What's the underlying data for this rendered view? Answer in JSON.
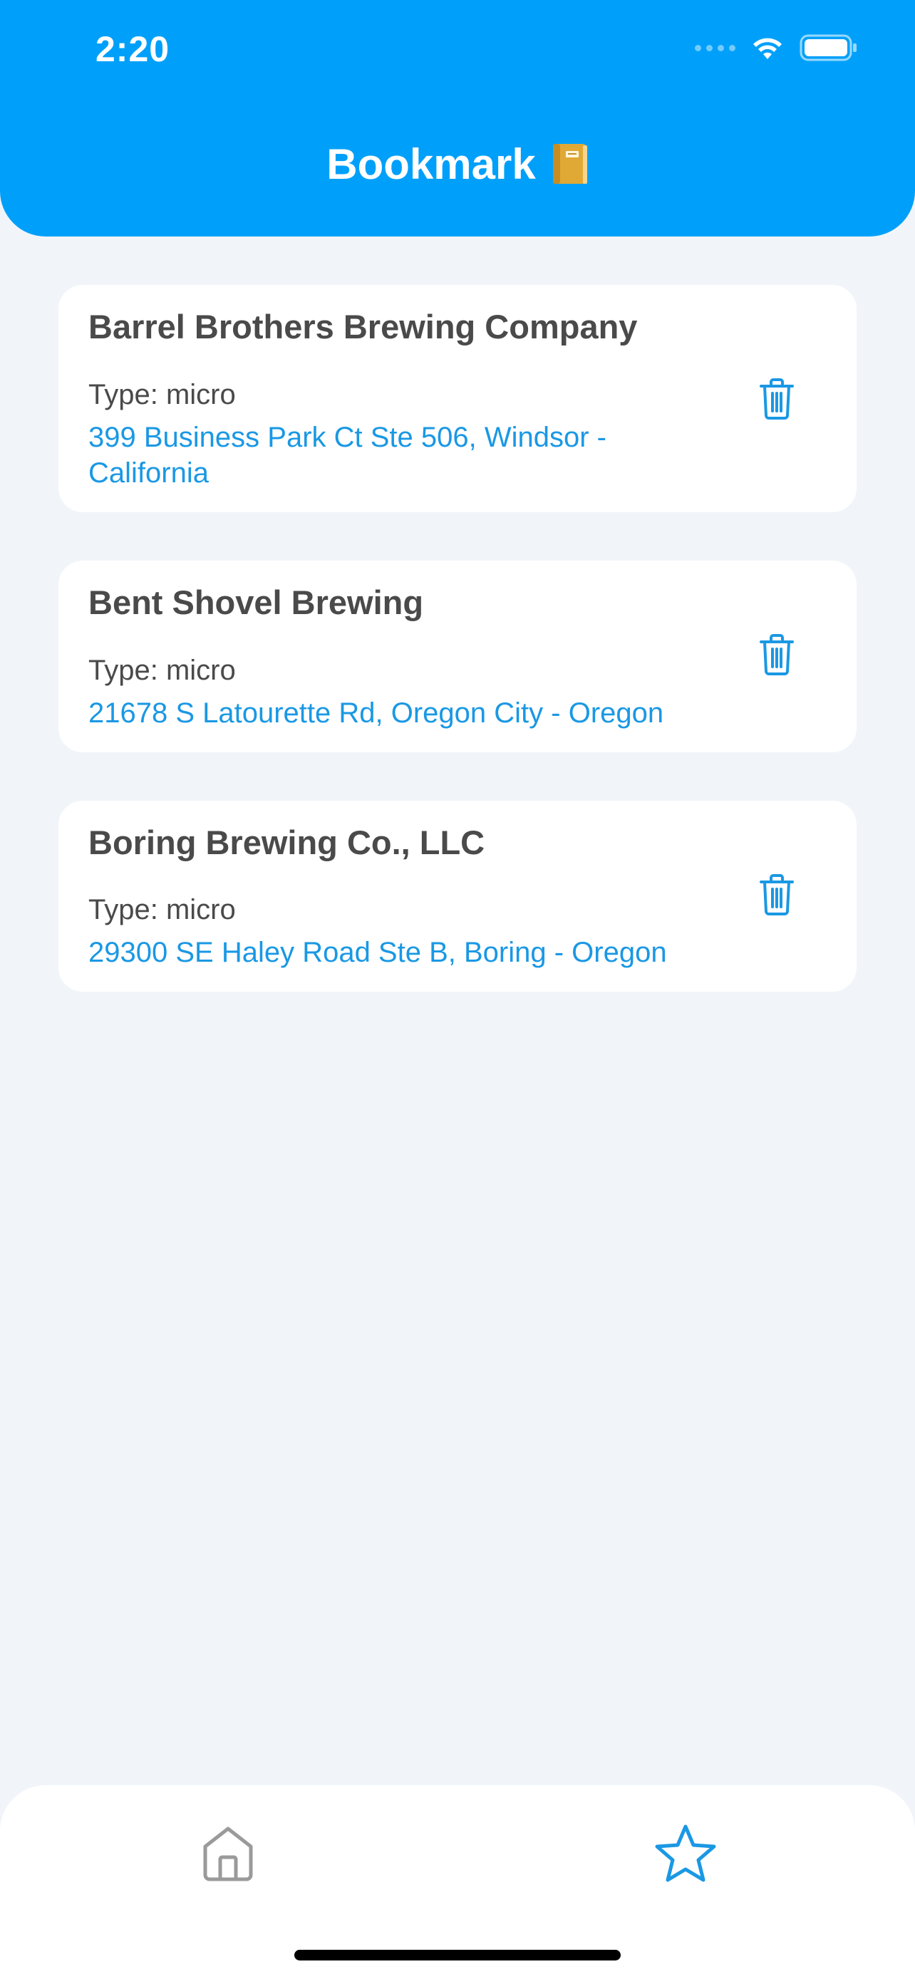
{
  "status_bar": {
    "time": "2:20"
  },
  "header": {
    "title": "Bookmark",
    "icon": "notebook-icon"
  },
  "bookmarks": [
    {
      "name": "Barrel Brothers Brewing Company",
      "type": "Type: micro",
      "address": "399 Business Park Ct Ste 506, Windsor - California",
      "action_icon": "trash-icon"
    },
    {
      "name": "Bent Shovel Brewing",
      "type": "Type: micro",
      "address": "21678 S Latourette Rd, Oregon City - Oregon",
      "action_icon": "trash-icon"
    },
    {
      "name": "Boring Brewing Co., LLC",
      "type": "Type: micro",
      "address": "29300 SE Haley Road Ste B, Boring - Oregon",
      "action_icon": "trash-icon"
    }
  ],
  "tabbar": {
    "tabs": [
      {
        "icon": "home-icon",
        "active": false
      },
      {
        "icon": "star-icon",
        "active": true
      }
    ]
  },
  "colors": {
    "accent": "#00a0fa",
    "link": "#1a98e4",
    "text": "#4a4a4a",
    "background": "#f1f5f9",
    "inactive_icon": "#9a9a9a"
  }
}
